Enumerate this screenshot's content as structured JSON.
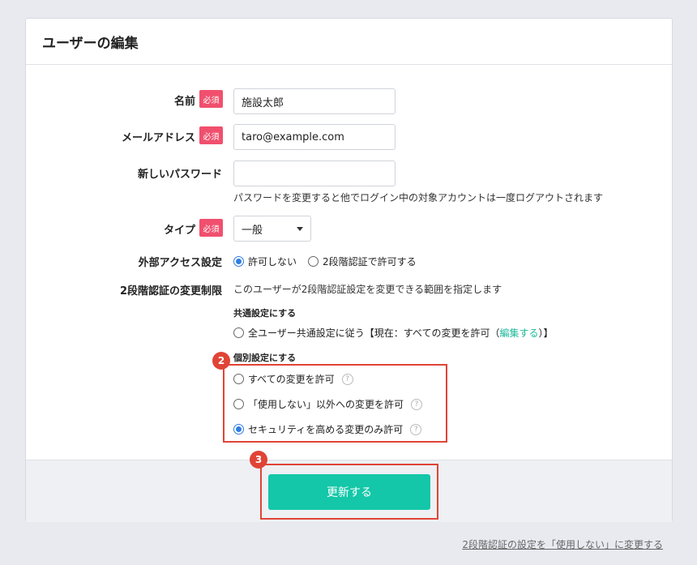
{
  "title": "ユーザーの編集",
  "required_label": "必須",
  "fields": {
    "name": {
      "label": "名前",
      "value": "施設太郎"
    },
    "email": {
      "label": "メールアドレス",
      "value": "taro@example.com"
    },
    "password": {
      "label": "新しいパスワード",
      "value": "",
      "help": "パスワードを変更すると他でログイン中の対象アカウントは一度ログアウトされます"
    },
    "type": {
      "label": "タイプ",
      "value": "一般"
    },
    "external_access": {
      "label": "外部アクセス設定",
      "options": [
        "許可しない",
        "2段階認証で許可する"
      ],
      "selected": 0
    },
    "twofa": {
      "label": "2段階認証の変更制限",
      "help": "このユーザーが2段階認証設定を変更できる範囲を指定します",
      "common_heading": "共通設定にする",
      "common_option": "全ユーザー共通設定に従う【現在：すべての変更を許可（",
      "common_link": "編集する",
      "common_option_end": "）】",
      "individual_heading": "個別設定にする",
      "individual_options": [
        "すべての変更を許可",
        "「使用しない」以外への変更を許可",
        "セキュリティを高める変更のみ許可"
      ],
      "selected_individual": 2
    }
  },
  "badges": {
    "b2": "2",
    "b3": "3"
  },
  "submit_label": "更新する",
  "bottom_link": "2段階認証の設定を「使用しない」に変更する",
  "colors": {
    "accent": "#14c7a8",
    "required": "#f0506e",
    "highlight": "#e04436",
    "radio": "#2f7de1"
  }
}
